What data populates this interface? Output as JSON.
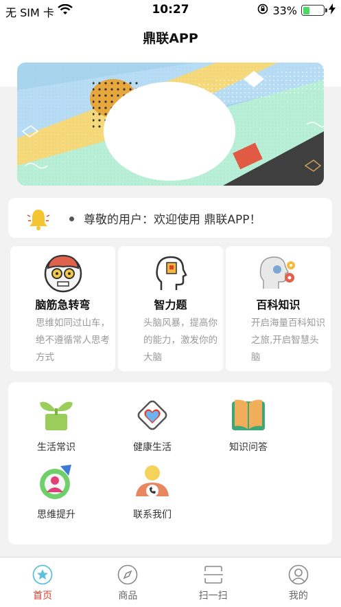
{
  "status_bar": {
    "carrier": "无 SIM 卡",
    "time": "10:27",
    "battery_percent": "33%",
    "battery_level": 0.33
  },
  "header": {
    "title": "鼎联APP"
  },
  "notice": {
    "text": "尊敬的用户：欢迎使用 鼎联APP！"
  },
  "cards": [
    {
      "title": "脑筋急转弯",
      "desc": "思维如同过山车，绝不遵循常人思考方式",
      "icon": "zombie-brain-icon"
    },
    {
      "title": "智力题",
      "desc": "头脑风暴，提高你的能力，激发你的大脑",
      "icon": "head-brain-icon"
    },
    {
      "title": "百科知识",
      "desc": "开启海量百科知识之旅,开启智慧头脑",
      "icon": "head-gears-icon"
    }
  ],
  "grid": [
    {
      "label": "生活常识",
      "icon": "sprout-icon"
    },
    {
      "label": "健康生活",
      "icon": "heart-diamond-icon"
    },
    {
      "label": "知识问答",
      "icon": "open-book-icon"
    },
    {
      "label": "思维提升",
      "icon": "person-chart-icon"
    },
    {
      "label": "联系我们",
      "icon": "phone-contact-icon"
    }
  ],
  "tabs": [
    {
      "label": "首页",
      "icon": "star-icon",
      "active": true
    },
    {
      "label": "商品",
      "icon": "compass-icon",
      "active": false
    },
    {
      "label": "扫一扫",
      "icon": "scan-icon",
      "active": false
    },
    {
      "label": "我的",
      "icon": "user-icon",
      "active": false
    }
  ],
  "colors": {
    "accent": "#e0402b",
    "tab_active_icon": "#5bc0de"
  }
}
